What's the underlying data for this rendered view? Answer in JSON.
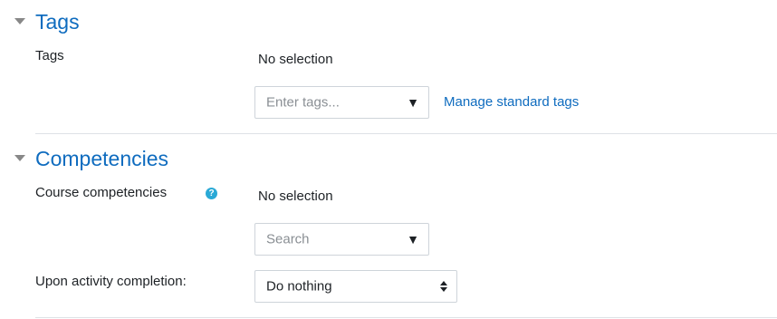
{
  "tags_section": {
    "title": "Tags",
    "field_label": "Tags",
    "selection_text": "No selection",
    "input_placeholder": "Enter tags...",
    "dropdown_arrow": "▼",
    "manage_link": "Manage standard tags"
  },
  "competencies_section": {
    "title": "Competencies",
    "field_label": "Course competencies",
    "help_icon": "?",
    "selection_text": "No selection",
    "search_placeholder": "Search",
    "dropdown_arrow": "▼",
    "completion_label": "Upon activity completion:",
    "completion_value": "Do nothing"
  },
  "colors": {
    "accent": "#0f6cbf",
    "help_icon": "#2aa9d6",
    "border": "#ced4da",
    "divider": "#dee2e6"
  },
  "icons": {
    "section_toggle": "chevron-down-icon",
    "help": "question-circle-icon",
    "dropdown": "dropdown-arrow-icon",
    "sort": "sort-caret-icon"
  }
}
